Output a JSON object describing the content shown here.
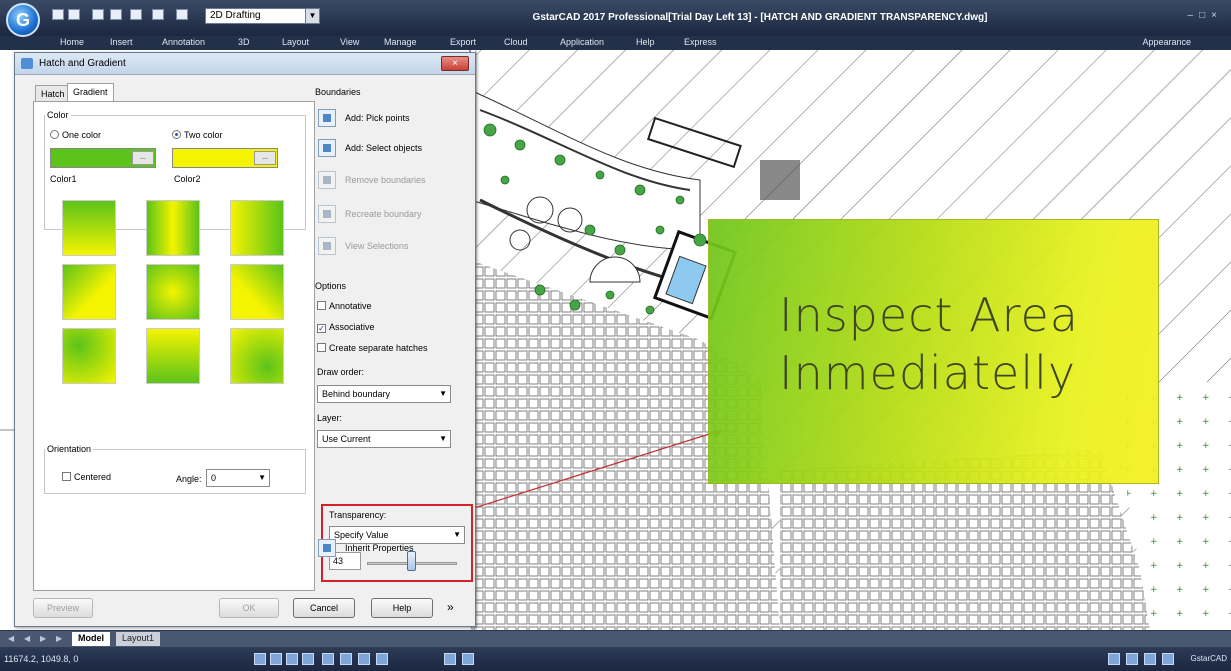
{
  "app": {
    "window_title": "GstarCAD 2017 Professional[Trial Day Left 13] - [HATCH AND GRADIENT TRANSPARENCY.dwg]",
    "workspace": "2D Drafting",
    "menu": [
      "Home",
      "Insert",
      "Annotation",
      "3D",
      "Layout",
      "View",
      "Manage",
      "Export",
      "Cloud",
      "Application",
      "Help",
      "Express"
    ],
    "appearance": "Appearance"
  },
  "dialog": {
    "title": "Hatch and Gradient",
    "tabs": [
      "Hatch",
      "Gradient"
    ],
    "active_tab": "Gradient",
    "color": {
      "legend": "Color",
      "one_color": "One color",
      "two_color": "Two color",
      "selected": "Two color",
      "color1_label": "Color1",
      "color2_label": "Color2",
      "color1_hex": "#5cc31a",
      "color2_hex": "#f4f400"
    },
    "orientation": {
      "legend": "Orientation",
      "centered": "Centered",
      "centered_checked": false,
      "angle_label": "Angle:",
      "angle_value": "0"
    },
    "boundaries": {
      "title": "Boundaries",
      "add_pick_points": "Add: Pick points",
      "add_select_objects": "Add: Select objects",
      "remove_boundaries": "Remove boundaries",
      "recreate_boundary": "Recreate boundary",
      "view_selections": "View Selections"
    },
    "options": {
      "title": "Options",
      "annotative": "Annotative",
      "associative": "Associative",
      "create_separate": "Create separate hatches",
      "annotative_checked": false,
      "associative_checked": true,
      "create_separate_checked": false,
      "draw_order_label": "Draw order:",
      "draw_order_value": "Behind boundary",
      "layer_label": "Layer:",
      "layer_value": "Use Current",
      "transparency_label": "Transparency:",
      "transparency_mode": "Specify Value",
      "transparency_value": "43",
      "inherit_properties": "Inherit Properties"
    },
    "buttons": {
      "preview": "Preview",
      "ok": "OK",
      "cancel": "Cancel",
      "help": "Help",
      "more": "»"
    }
  },
  "callout": {
    "line1": "Inspect Area",
    "line2": "Inmediatelly"
  },
  "layout_tabs": [
    "Model",
    "Layout1"
  ],
  "active_layout": "Model",
  "status": {
    "coords": "11674.2, 1049.8, 0",
    "app_label": "GstarCAD"
  }
}
